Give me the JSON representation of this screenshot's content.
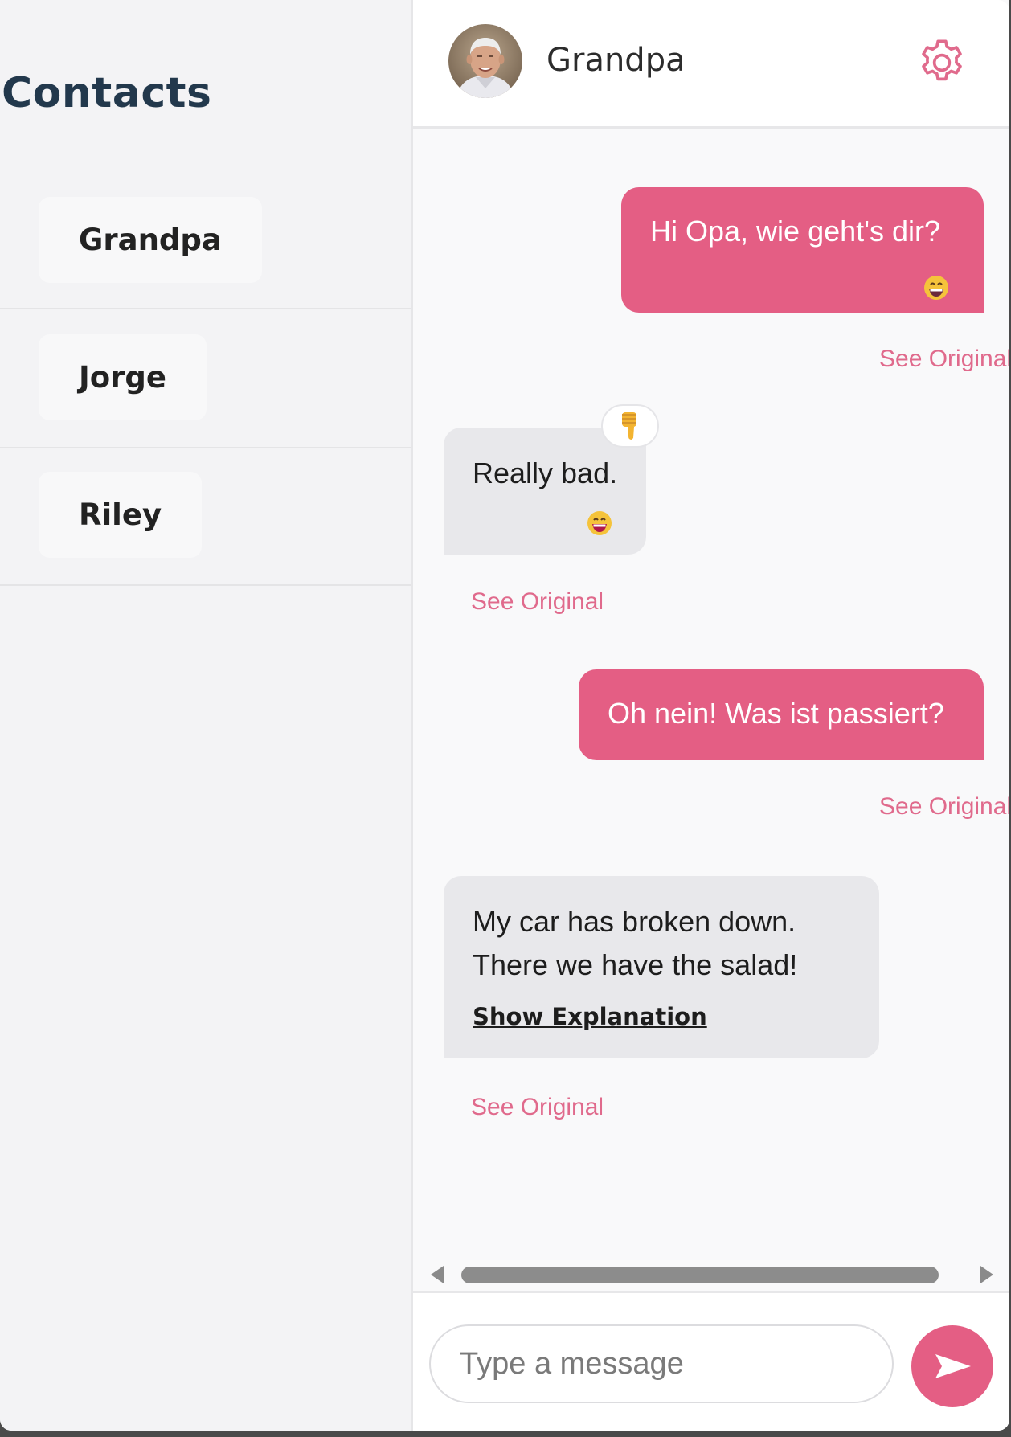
{
  "sidebar": {
    "title": "Contacts",
    "contacts": [
      {
        "label": "Grandpa"
      },
      {
        "label": "Jorge"
      },
      {
        "label": "Riley"
      }
    ]
  },
  "chat": {
    "header": {
      "name": "Grandpa",
      "settings_icon": "gear-icon"
    },
    "messages": [
      {
        "direction": "outgoing",
        "text": "Hi Opa, wie geht's dir?",
        "emoji": "grinning-face",
        "link": "See Original"
      },
      {
        "direction": "incoming",
        "text": "Really bad.",
        "emoji": "grinning-face",
        "reaction": "thumbs-down",
        "link": "See Original"
      },
      {
        "direction": "outgoing",
        "text": "Oh nein! Was ist passiert?",
        "link": "See Original"
      },
      {
        "direction": "incoming",
        "lines": [
          "My car has broken down.",
          "There we have the salad!"
        ],
        "explanation_label": "Show Explanation",
        "link": "See Original"
      }
    ],
    "composer": {
      "placeholder": "Type a message",
      "value": "",
      "send_icon": "send-arrow-icon"
    }
  },
  "colors": {
    "accent": "#e45e84",
    "link": "#e06a8c",
    "incoming_bubble": "#e8e8eb",
    "sidebar_title": "#22384c"
  }
}
